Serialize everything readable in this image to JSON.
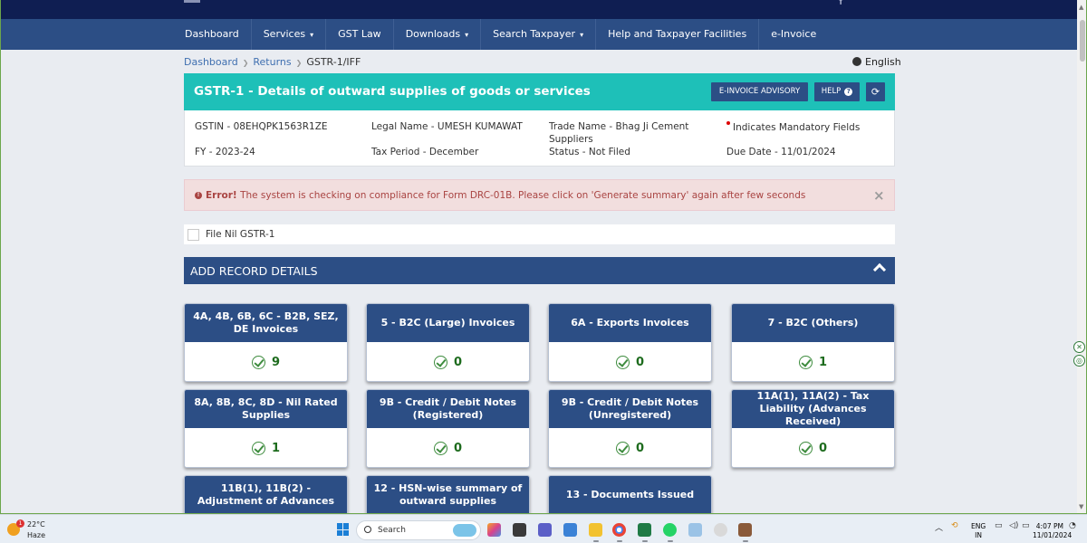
{
  "nav": {
    "items": [
      {
        "label": "Dashboard",
        "caret": ""
      },
      {
        "label": "Services",
        "caret": "▾"
      },
      {
        "label": "GST Law",
        "caret": ""
      },
      {
        "label": "Downloads",
        "caret": "▾"
      },
      {
        "label": "Search Taxpayer",
        "caret": "▾"
      },
      {
        "label": "Help and Taxpayer Facilities",
        "caret": ""
      },
      {
        "label": "e-Invoice",
        "caret": ""
      }
    ]
  },
  "breadcrumb": {
    "items": [
      "Dashboard",
      "Returns"
    ],
    "current": "GSTR-1/IFF"
  },
  "language": "English",
  "header": {
    "title": "GSTR-1 - Details of outward supplies of goods or services",
    "advisory_label": "E-INVOICE ADVISORY",
    "help_label": "HELP",
    "help_icon": "?",
    "refresh_icon": "⟳",
    "color": "#1ec0b8"
  },
  "info": {
    "gstin": "GSTIN - 08EHQPK1563R1ZE",
    "legal_name": "Legal Name - UMESH KUMAWAT",
    "trade_name_line1": "Trade Name - Bhag Ji Cement",
    "trade_name_line2": "Suppliers",
    "mandatory": "Indicates Mandatory Fields",
    "fy": "FY - 2023-24",
    "tax_period": "Tax Period - December",
    "status": "Status - Not Filed",
    "due_date": "Due Date - 11/01/2024"
  },
  "error": {
    "icon": "!",
    "strong": "Error!",
    "message": "The system is checking on compliance for Form DRC-01B. Please click on 'Generate summary' again after few seconds",
    "close": "×"
  },
  "nil": {
    "label": "File Nil GSTR-1"
  },
  "section": {
    "title": "ADD RECORD DETAILS"
  },
  "tiles": [
    {
      "title": "4A, 4B, 6B, 6C - B2B, SEZ, DE Invoices",
      "count": "9"
    },
    {
      "title": "5 - B2C (Large) Invoices",
      "count": "0"
    },
    {
      "title": "6A - Exports Invoices",
      "count": "0"
    },
    {
      "title": "7 - B2C (Others)",
      "count": "1"
    },
    {
      "title": "8A, 8B, 8C, 8D - Nil Rated Supplies",
      "count": "1"
    },
    {
      "title": "9B - Credit / Debit Notes (Registered)",
      "count": "0"
    },
    {
      "title": "9B - Credit / Debit Notes (Unregistered)",
      "count": "0"
    },
    {
      "title": "11A(1), 11A(2) - Tax Liability (Advances Received)",
      "count": "0"
    },
    {
      "title": "11B(1), 11B(2) - Adjustment of Advances",
      "count": ""
    },
    {
      "title": "12 - HSN-wise summary of outward supplies",
      "count": ""
    },
    {
      "title": "13 - Documents Issued",
      "count": ""
    }
  ],
  "taskbar": {
    "weather_temp": "22°C",
    "weather_cond": "Haze",
    "weather_badge": "1",
    "search_label": "Search",
    "lang_line1": "ENG",
    "lang_line2": "IN",
    "time": "4:07 PM",
    "date": "11/01/2024"
  }
}
